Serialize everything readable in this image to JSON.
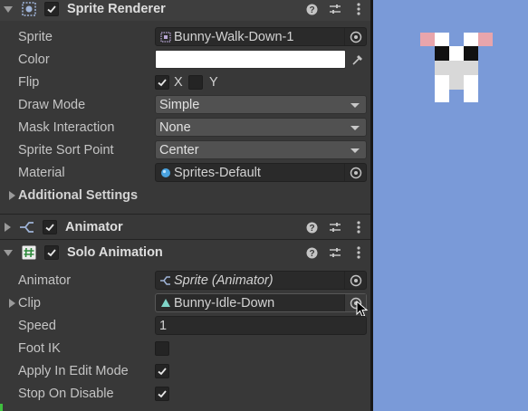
{
  "sprite_renderer": {
    "title": "Sprite Renderer",
    "sprite_label": "Sprite",
    "sprite_value": "Bunny-Walk-Down-1",
    "color_label": "Color",
    "color_value": "#ffffff",
    "flip_label": "Flip",
    "flip_x": "X",
    "flip_y": "Y",
    "draw_mode_label": "Draw Mode",
    "draw_mode_value": "Simple",
    "mask_label": "Mask Interaction",
    "mask_value": "None",
    "sort_point_label": "Sprite Sort Point",
    "sort_point_value": "Center",
    "material_label": "Material",
    "material_value": "Sprites-Default",
    "additional_settings": "Additional Settings"
  },
  "animator": {
    "title": "Animator"
  },
  "solo_animation": {
    "title": "Solo Animation",
    "animator_label": "Animator",
    "animator_value": "Sprite (Animator)",
    "clip_label": "Clip",
    "clip_value": "Bunny-Idle-Down",
    "speed_label": "Speed",
    "speed_value": "1",
    "foot_ik_label": "Foot IK",
    "apply_edit_label": "Apply In Edit Mode",
    "stop_disable_label": "Stop On Disable"
  },
  "colors": {
    "scene_bg": "#7a9ad8",
    "panel_bg": "#383838",
    "header_bg": "#3e3e3e"
  }
}
